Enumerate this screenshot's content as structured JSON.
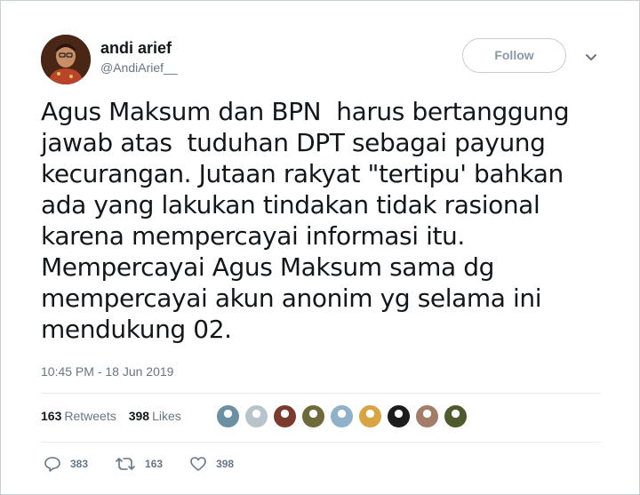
{
  "user": {
    "display_name": "andi arief",
    "handle": "@AndiArief__"
  },
  "follow_label": "Follow",
  "tweet": {
    "text": "Agus Maksum dan BPN  harus bertanggung\njawab atas  tuduhan DPT sebagai payung\nkecurangan. Jutaan rakyat \"tertipu' bahkan\nada yang lakukan tindakan tidak rasional\nkarena mempercayai informasi itu.\nMempercayai Agus Maksum sama dg\nmempercayai akun anonim yg selama ini\nmendukung 02.",
    "timestamp": "10:45 PM - 18 Jun 2019"
  },
  "stats": {
    "retweets_count": "163",
    "retweets_label": "Retweets",
    "likes_count": "398",
    "likes_label": "Likes"
  },
  "likers": [
    {
      "icon": "avatar-1",
      "color": "#6b8fa3"
    },
    {
      "icon": "avatar-2",
      "color": "#b8c4cc"
    },
    {
      "icon": "avatar-3",
      "color": "#7a3b2e"
    },
    {
      "icon": "avatar-4",
      "color": "#6e6a3a"
    },
    {
      "icon": "avatar-5",
      "color": "#8fb1c9"
    },
    {
      "icon": "avatar-6",
      "color": "#d9a443"
    },
    {
      "icon": "avatar-7",
      "color": "#1c1c1c"
    },
    {
      "icon": "avatar-8",
      "color": "#a47c6a"
    },
    {
      "icon": "avatar-9",
      "color": "#4d5a2c"
    }
  ],
  "actions": {
    "reply_count": "383",
    "retweet_count": "163",
    "like_count": "398"
  },
  "colors": {
    "text": "#14171a",
    "muted": "#657786",
    "border": "#e6ecf0"
  }
}
